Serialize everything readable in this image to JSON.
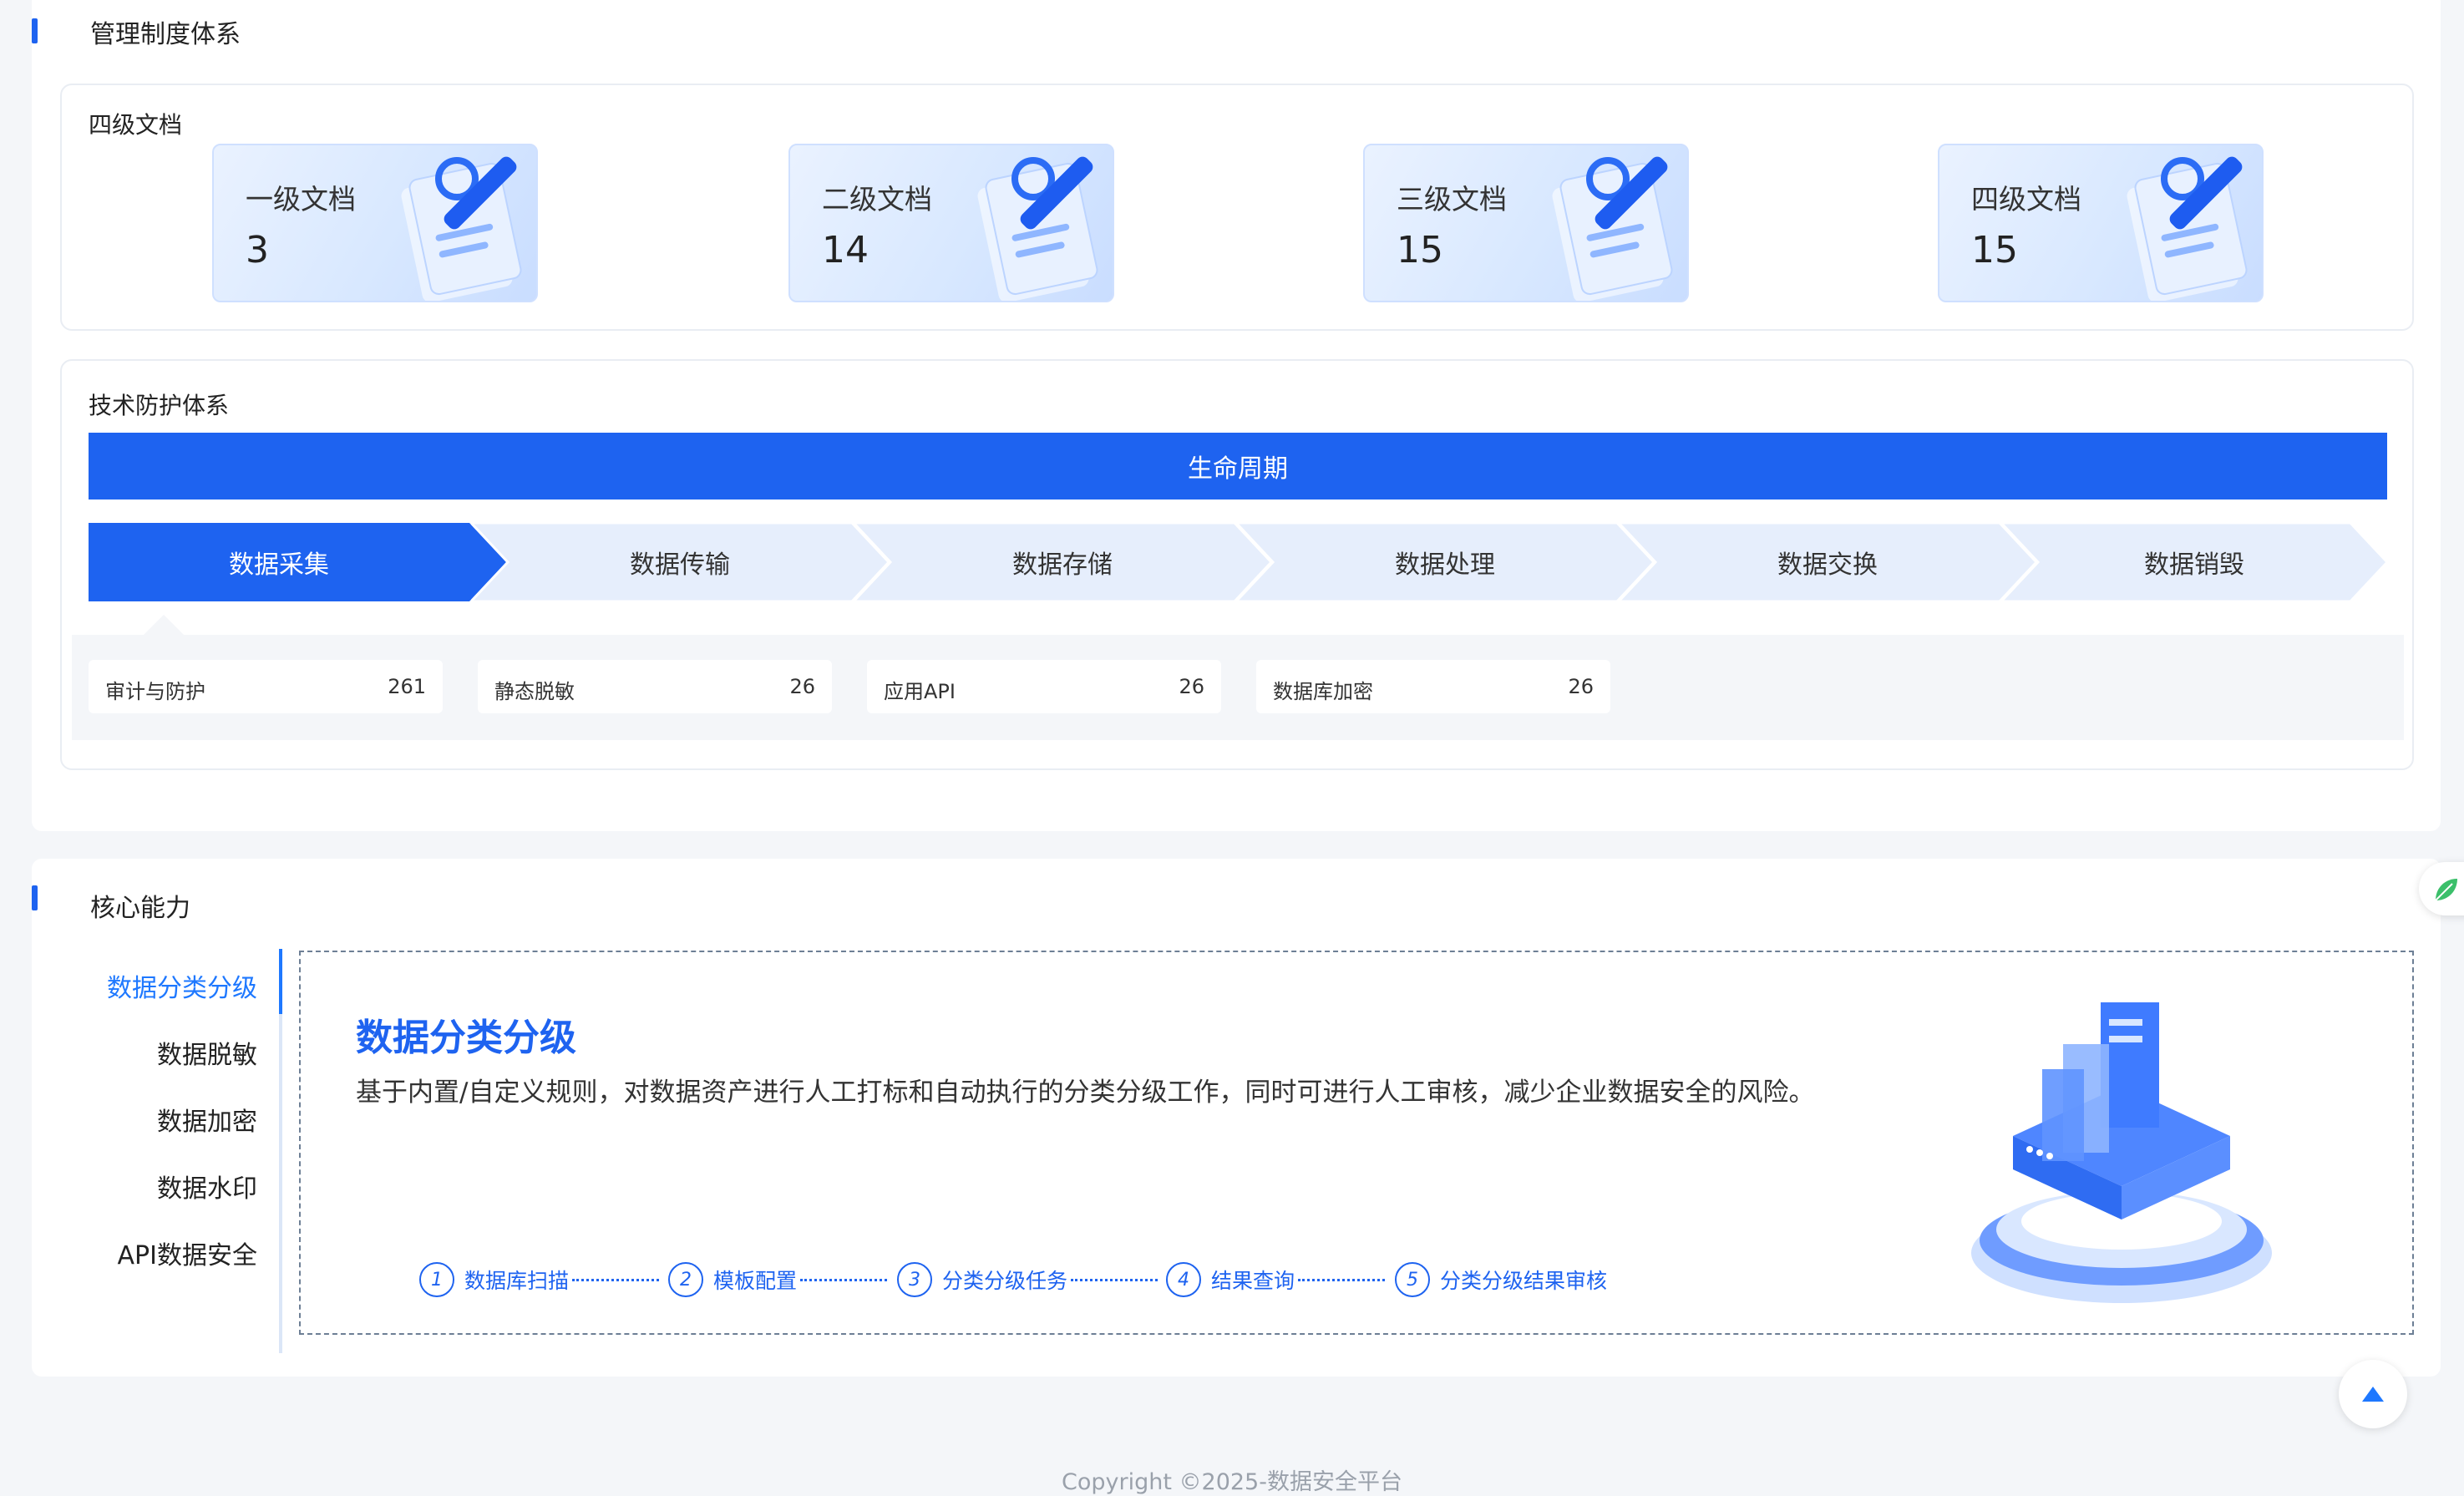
{
  "management": {
    "title": "管理制度体系",
    "card_label": "四级文档",
    "docs": [
      {
        "name": "一级文档",
        "value": "3"
      },
      {
        "name": "二级文档",
        "value": "14"
      },
      {
        "name": "三级文档",
        "value": "15"
      },
      {
        "name": "四级文档",
        "value": "15"
      }
    ]
  },
  "tech": {
    "card_label": "技术防护体系",
    "lifecycle_label": "生命周期",
    "stages": [
      "数据采集",
      "数据传输",
      "数据存储",
      "数据处理",
      "数据交换",
      "数据销毁"
    ],
    "active_stage": "数据采集",
    "metrics": [
      {
        "name": "审计与防护",
        "value": "261"
      },
      {
        "name": "静态脱敏",
        "value": "26"
      },
      {
        "name": "应用API",
        "value": "26"
      },
      {
        "name": "数据库加密",
        "value": "26"
      }
    ]
  },
  "core": {
    "title": "核心能力",
    "tabs": [
      "数据分类分级",
      "数据脱敏",
      "数据加密",
      "数据水印",
      "API数据安全"
    ],
    "active_tab": "数据分类分级",
    "detail": {
      "title": "数据分类分级",
      "description": "基于内置/自定义规则，对数据资产进行人工打标和自动执行的分类分级工作，同时可进行人工审核，减少企业数据安全的风险。",
      "steps": [
        {
          "num": "1",
          "label": "数据库扫描"
        },
        {
          "num": "2",
          "label": "模板配置"
        },
        {
          "num": "3",
          "label": "分类分级任务"
        },
        {
          "num": "4",
          "label": "结果查询"
        },
        {
          "num": "5",
          "label": "分类分级结果审核"
        }
      ]
    }
  },
  "footer": {
    "copyright": "Copyright ©2025-数据安全平台"
  },
  "colors": {
    "primary": "#1e63f0",
    "tab_active": "#1e78ff",
    "stage_inactive": "#e6eefc"
  },
  "icons": {
    "doc_tile": "document-edit-illustration",
    "back_to_top": "caret-up-icon",
    "side_widget": "leaf-icon",
    "hero": "data-server-illustration"
  }
}
